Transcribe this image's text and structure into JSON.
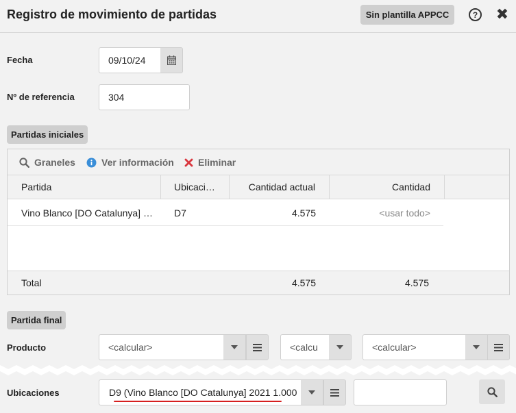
{
  "header": {
    "title": "Registro de movimiento de partidas",
    "appcc_label": "Sin plantilla APPCC",
    "help_label": "?",
    "close_label": "✖"
  },
  "form": {
    "fecha_label": "Fecha",
    "fecha_value": "09/10/24",
    "referencia_label": "Nº de referencia",
    "referencia_value": "304"
  },
  "partidas_iniciales": {
    "section_label": "Partidas iniciales",
    "toolbar": {
      "graneles": "Graneles",
      "ver_informacion": "Ver información",
      "eliminar": "Eliminar"
    },
    "columns": [
      "Partida",
      "Ubicaci…",
      "Cantidad actual",
      "Cantidad"
    ],
    "rows": [
      {
        "partida": "Vino Blanco [DO Catalunya] …",
        "ubicacion": "D7",
        "cantidad_actual": "4.575",
        "cantidad": "<usar todo>"
      }
    ],
    "total": {
      "label": "Total",
      "cantidad_actual": "4.575",
      "cantidad": "4.575"
    }
  },
  "partida_final": {
    "section_label": "Partida final",
    "producto_label": "Producto",
    "producto_placeholder_1": "<calcular>",
    "producto_placeholder_2": "<calcu",
    "producto_placeholder_3": "<calcular>",
    "ubicaciones_label": "Ubicaciones",
    "ubicaciones_value": "D9 (Vino Blanco [DO Catalunya] 2021 1.000",
    "ubicaciones_extra_value": ""
  },
  "colors": {
    "background": "#f2f2f2",
    "chip": "#cfcfcf",
    "info_blue": "#3a8ed8",
    "delete_red": "#d9363e",
    "underline_red": "#d61f1f"
  }
}
